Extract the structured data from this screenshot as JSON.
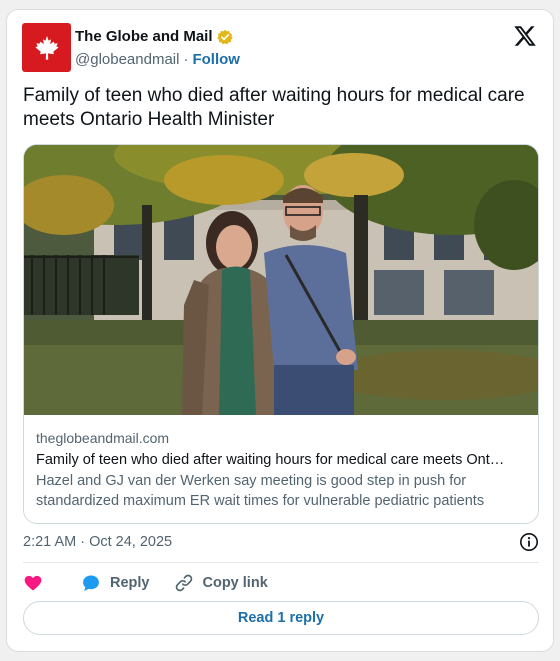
{
  "author": {
    "name": "The Globe and Mail",
    "handle": "@globeandmail",
    "separator": "·",
    "follow_label": "Follow",
    "avatar_icon": "maple-leaf-icon",
    "verified_icon": "gold-verified-badge-icon"
  },
  "platform_icon": "x-logo-icon",
  "tweet": {
    "text": "Family of teen who died after waiting hours for medical care meets Ontario Health Minister"
  },
  "link_card": {
    "image_description_icon": "photo",
    "domain": "theglobeandmail.com",
    "title": "Family of teen who died after waiting hours for medical care meets Ont…",
    "description": "Hazel and GJ van der Werken say meeting is good step in push for standardized maximum ER wait times for vulnerable pediatric patients"
  },
  "meta": {
    "timestamp": "2:21 AM · Oct 24, 2025",
    "info_icon": "info-icon"
  },
  "actions": {
    "like_icon": "heart-icon",
    "reply_label": "Reply",
    "copy_link_label": "Copy link"
  },
  "read_reply_label": "Read 1 reply",
  "colors": {
    "brand_red": "#d71920",
    "link_blue": "#1d6fa8",
    "like_pink": "#f91880",
    "reply_blue": "#1d9bf0",
    "secondary_text": "#536471"
  }
}
